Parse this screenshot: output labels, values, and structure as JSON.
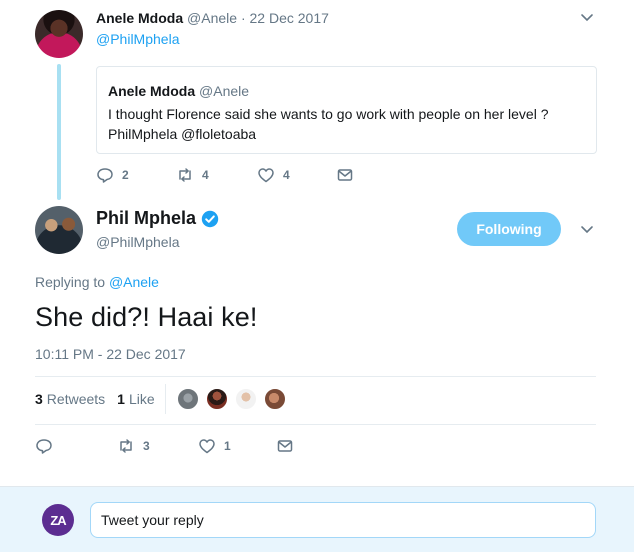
{
  "parent_tweet": {
    "author_name": "Anele Mdoda",
    "author_handle": "@Anele",
    "date": "22 Dec 2017",
    "reply_mention": "@PhilMphela",
    "quote": {
      "author_name": "Anele Mdoda",
      "author_handle": "@Anele",
      "text": "I thought Florence said she wants to go work with people on her level ? PhilMphela @floletoaba"
    },
    "actions": {
      "replies": "2",
      "retweets": "4",
      "likes": "4"
    }
  },
  "main_tweet": {
    "author_name": "Phil Mphela",
    "author_handle": "@PhilMphela",
    "follow_label": "Following",
    "replying_prefix": "Replying to",
    "replying_to": "@Anele",
    "text": "She did?! Haai ke!",
    "timestamp": "10:11 PM - 22 Dec 2017",
    "stats": {
      "retweets_count": "3",
      "retweets_label": "Retweets",
      "likes_count": "1",
      "likes_label": "Like"
    },
    "actions": {
      "retweets": "3",
      "likes": "1"
    }
  },
  "reply_bar": {
    "logo_text": "ZA",
    "placeholder": "Tweet your reply"
  },
  "colors": {
    "accent": "#1da1f2",
    "follow_button": "#71c9f8",
    "thread_line": "#a8e0f2",
    "muted_text": "#657786",
    "logo": "#5c2d91"
  },
  "icons": [
    "reply-icon",
    "retweet-icon",
    "like-icon",
    "message-icon",
    "chevron-down-icon",
    "verified-icon"
  ]
}
